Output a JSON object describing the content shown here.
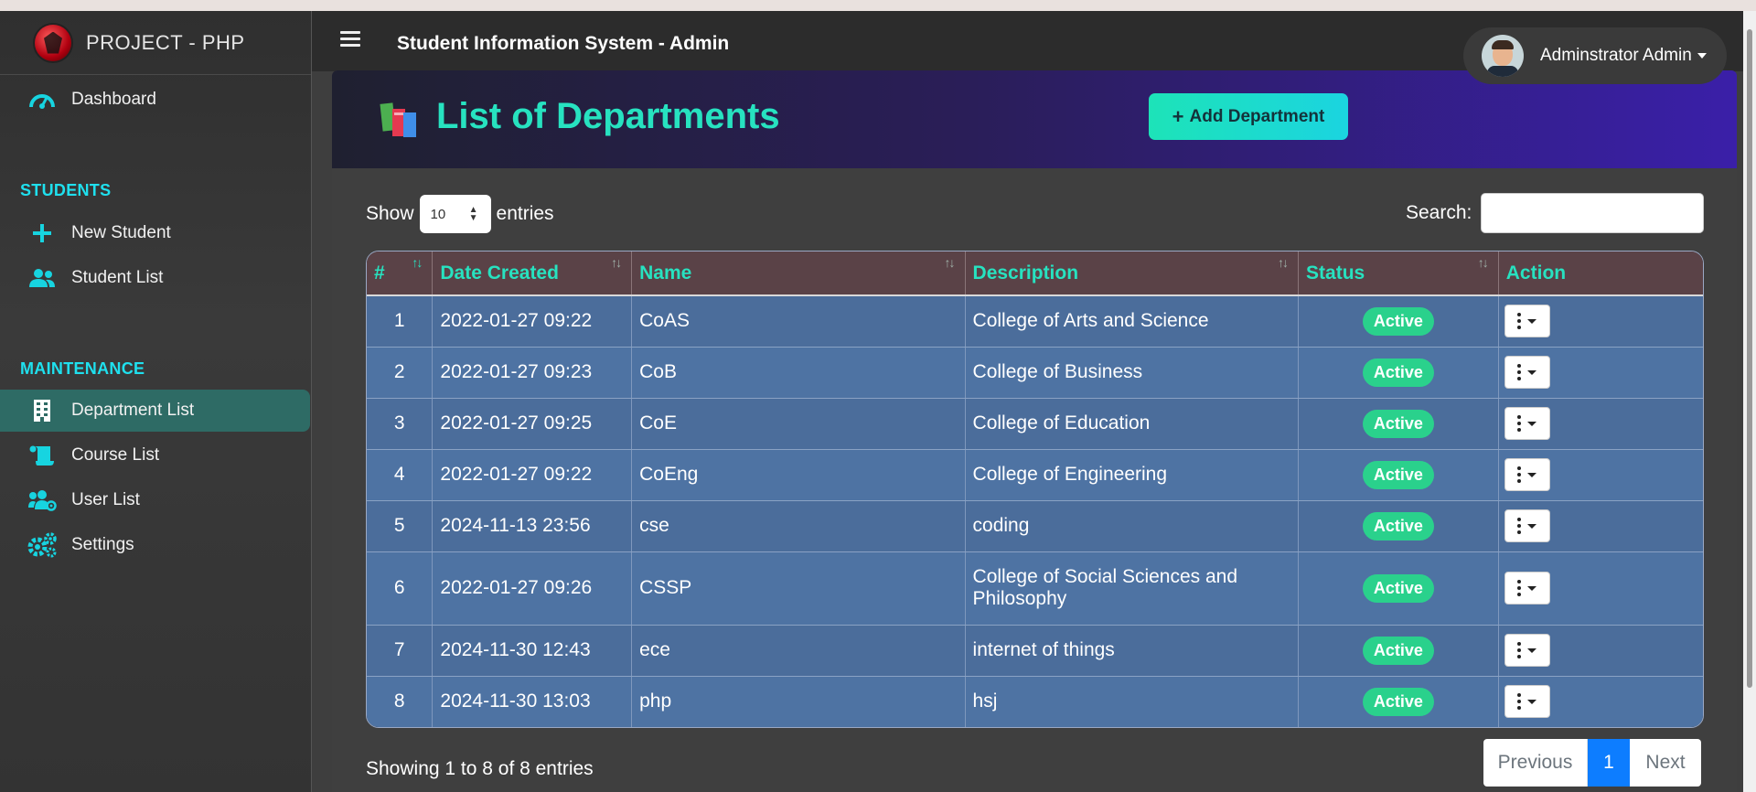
{
  "brand": {
    "name": "PROJECT - PHP"
  },
  "sidebar": {
    "items": [
      {
        "label": "Dashboard",
        "icon": "speedometer-icon"
      },
      {
        "section": "STUDENTS"
      },
      {
        "label": "New Student",
        "icon": "plus-icon"
      },
      {
        "label": "Student List",
        "icon": "users-icon"
      },
      {
        "section": "MAINTENANCE"
      },
      {
        "label": "Department List",
        "icon": "building-icon",
        "active": true
      },
      {
        "label": "Course List",
        "icon": "scroll-icon"
      },
      {
        "label": "User List",
        "icon": "users-cog-icon"
      },
      {
        "label": "Settings",
        "icon": "gears-icon"
      }
    ],
    "dashboard": "Dashboard",
    "students_header": "STUDENTS",
    "new_student": "New Student",
    "student_list": "Student List",
    "maintenance_header": "MAINTENANCE",
    "department_list": "Department List",
    "course_list": "Course List",
    "user_list": "User List",
    "settings": "Settings"
  },
  "header": {
    "title": "Student Information System - Admin",
    "user": "Adminstrator Admin"
  },
  "page": {
    "title": "List of Departments",
    "add_button": "Add Department",
    "show_label": "Show",
    "entries_value": "10",
    "entries_label": "entries",
    "search_label": "Search:",
    "search_value": ""
  },
  "table": {
    "columns": [
      "#",
      "Date Created",
      "Name",
      "Description",
      "Status",
      "Action"
    ],
    "rows": [
      {
        "num": "1",
        "date": "2022-01-27 09:22",
        "name": "CoAS",
        "description": "College of Arts and Science",
        "status": "Active"
      },
      {
        "num": "2",
        "date": "2022-01-27 09:23",
        "name": "CoB",
        "description": "College of Business",
        "status": "Active"
      },
      {
        "num": "3",
        "date": "2022-01-27 09:25",
        "name": "CoE",
        "description": "College of Education",
        "status": "Active"
      },
      {
        "num": "4",
        "date": "2022-01-27 09:22",
        "name": "CoEng",
        "description": "College of Engineering",
        "status": "Active"
      },
      {
        "num": "5",
        "date": "2024-11-13 23:56",
        "name": "cse",
        "description": "coding",
        "status": "Active"
      },
      {
        "num": "6",
        "date": "2022-01-27 09:26",
        "name": "CSSP",
        "description": "College of Social Sciences and Philosophy",
        "status": "Active"
      },
      {
        "num": "7",
        "date": "2024-11-30 12:43",
        "name": "ece",
        "description": "internet of things",
        "status": "Active"
      },
      {
        "num": "8",
        "date": "2024-11-30 13:03",
        "name": "php",
        "description": "hsj",
        "status": "Active"
      }
    ]
  },
  "footer": {
    "info": "Showing 1 to 8 of 8 entries",
    "prev": "Previous",
    "current_page": "1",
    "next": "Next"
  },
  "colors": {
    "accent": "#27e2c0",
    "sidebar_icon": "#17d4e0",
    "status_active": "#2ad18c",
    "row": "#4b6d9b",
    "page_active": "#0d7dff"
  }
}
